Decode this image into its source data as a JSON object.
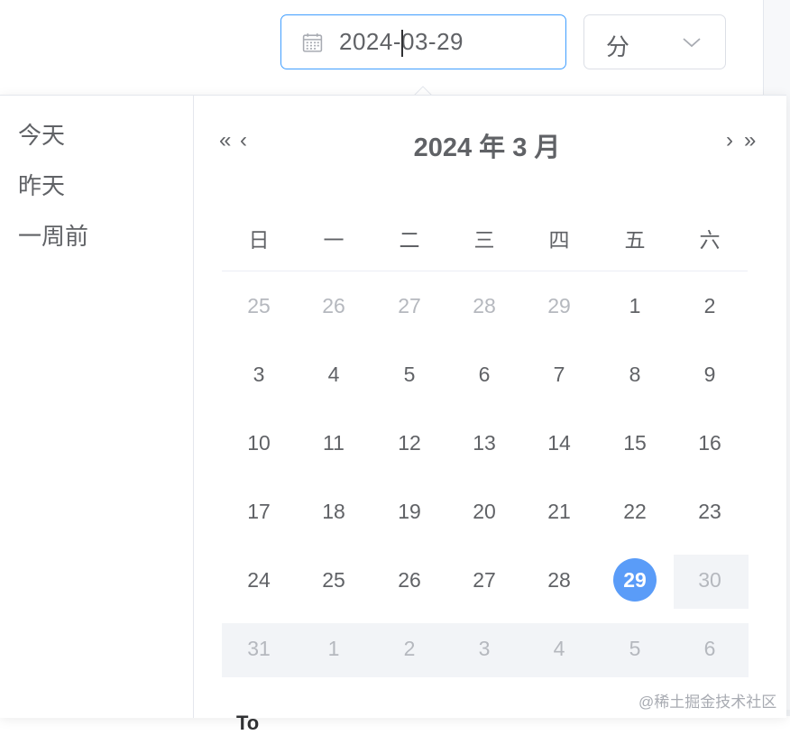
{
  "toolbar": {
    "date_value": "2024-03-29",
    "unit_value": "分",
    "calendar_icon": "calendar-icon",
    "chevron_icon": "chevron-down-icon"
  },
  "picker": {
    "shortcuts": [
      "今天",
      "昨天",
      "一周前"
    ],
    "header": {
      "title": "2024 年  3 月",
      "prev_year": "«",
      "prev_month": "‹",
      "next_month": "›",
      "next_year": "»"
    },
    "weekdays": [
      "日",
      "一",
      "二",
      "三",
      "四",
      "五",
      "六"
    ],
    "weeks": [
      [
        {
          "d": "25",
          "o": true
        },
        {
          "d": "26",
          "o": true
        },
        {
          "d": "27",
          "o": true
        },
        {
          "d": "28",
          "o": true
        },
        {
          "d": "29",
          "o": true
        },
        {
          "d": "1"
        },
        {
          "d": "2"
        }
      ],
      [
        {
          "d": "3"
        },
        {
          "d": "4"
        },
        {
          "d": "5"
        },
        {
          "d": "6"
        },
        {
          "d": "7"
        },
        {
          "d": "8"
        },
        {
          "d": "9"
        }
      ],
      [
        {
          "d": "10"
        },
        {
          "d": "11"
        },
        {
          "d": "12"
        },
        {
          "d": "13"
        },
        {
          "d": "14"
        },
        {
          "d": "15"
        },
        {
          "d": "16"
        }
      ],
      [
        {
          "d": "17"
        },
        {
          "d": "18"
        },
        {
          "d": "19"
        },
        {
          "d": "20"
        },
        {
          "d": "21"
        },
        {
          "d": "22"
        },
        {
          "d": "23"
        }
      ],
      [
        {
          "d": "24"
        },
        {
          "d": "25"
        },
        {
          "d": "26"
        },
        {
          "d": "27"
        },
        {
          "d": "28"
        },
        {
          "d": "29",
          "s": true
        },
        {
          "d": "30",
          "o": true
        }
      ],
      [
        {
          "d": "31",
          "o": true
        },
        {
          "d": "1",
          "o": true
        },
        {
          "d": "2",
          "o": true
        },
        {
          "d": "3",
          "o": true
        },
        {
          "d": "4",
          "o": true
        },
        {
          "d": "5",
          "o": true
        },
        {
          "d": "6",
          "o": true
        }
      ]
    ],
    "footer_peek": "To"
  },
  "colors": {
    "accent": "#409eff",
    "selected_bg": "#5a9cf8",
    "muted_text": "#b5b8be",
    "text": "#606266"
  },
  "watermark": "@稀土掘金技术社区"
}
